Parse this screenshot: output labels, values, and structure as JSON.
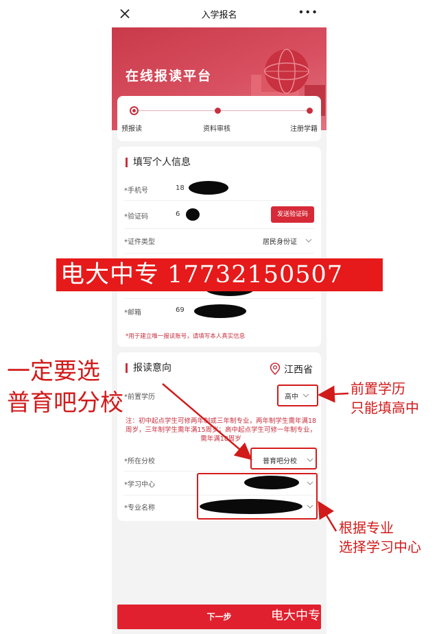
{
  "nav": {
    "title": "入学报名",
    "more": "•••"
  },
  "banner": {
    "title": "在线报读平台"
  },
  "steps": [
    {
      "label": "预报读",
      "active": true
    },
    {
      "label": "资料审核",
      "active": false
    },
    {
      "label": "注册学籍",
      "active": false
    }
  ],
  "personal": {
    "title": "填写个人信息",
    "phone_label": "*手机号",
    "phone_value": "18",
    "code_label": "*验证码",
    "code_value": "6",
    "send_code": "发送验证码",
    "id_type_label": "*证件类型",
    "id_type_value": "居民身份证",
    "email_label": "*邮箱",
    "email_value": "69",
    "hint": "*用于建立唯一报读账号，请填写本人真实信息"
  },
  "intent": {
    "title": "报读意向",
    "province": "江西省",
    "edu_label": "*前置学历",
    "edu_value": "高中",
    "note": "注：初中起点学生可修两年制或三年制专业，两年制学生需年满18周岁，三年制学生需年满15周岁；高中起点学生可修一年制专业，需年满18周岁",
    "branch_label": "*所在分校",
    "branch_value": "普育吧分校",
    "center_label": "*学习中心",
    "major_label": "*专业名称"
  },
  "next_button": "下一步",
  "watermark": {
    "banner": "电大中专 17732150507",
    "bottom": "电大中专"
  },
  "annotations": {
    "must_select_line1": "一定要选",
    "must_select_line2": "普育吧分校",
    "edu_line1": "前置学历",
    "edu_line2": "只能填高中",
    "major_line1": "根据专业",
    "major_line2": "选择学习中心"
  },
  "colors": {
    "brand_red": "#c8303f",
    "button_red": "#e0202e",
    "annotation_red": "#d11a1a"
  }
}
